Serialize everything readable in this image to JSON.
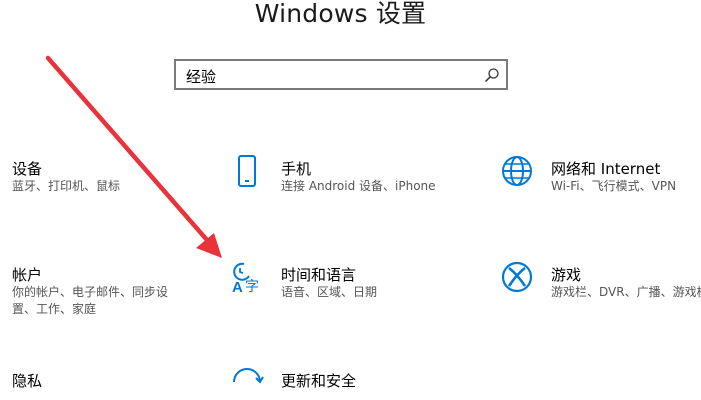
{
  "window": {
    "title": "Windows 设置"
  },
  "search": {
    "value": "经验"
  },
  "settings": {
    "devices": {
      "name": "设备",
      "desc": "蓝牙、打印机、鼠标"
    },
    "phone": {
      "name": "手机",
      "desc": "连接 Android 设备、iPhone"
    },
    "network": {
      "name": "网络和 Internet",
      "desc": "Wi-Fi、飞行模式、VPN"
    },
    "accounts": {
      "name": "帐户",
      "desc_line1": "你的帐户、电子邮件、同步设",
      "desc_line2": "置、工作、家庭"
    },
    "time_language": {
      "name": "时间和语言",
      "desc": "语音、区域、日期"
    },
    "gaming": {
      "name": "游戏",
      "desc": "游戏栏、DVR、广播、游戏模"
    },
    "privacy": {
      "name": "隐私"
    },
    "update_security": {
      "name": "更新和安全"
    }
  },
  "colors": {
    "accent": "#0078d7",
    "arrow": "#e8333b"
  }
}
